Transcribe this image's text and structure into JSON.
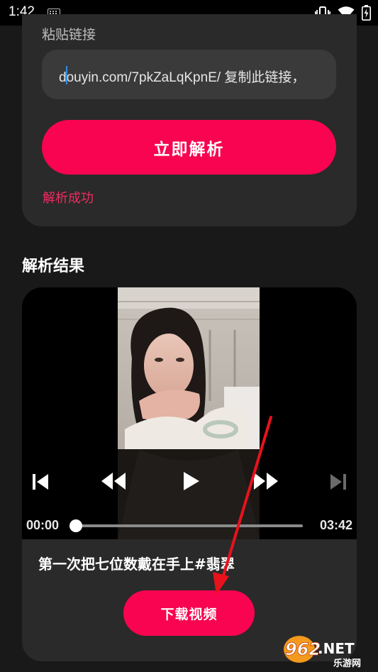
{
  "status_bar": {
    "time": "1:42"
  },
  "parse_card": {
    "paste_label": "粘贴链接",
    "input_value": "douyin.com/7pkZaLqKpnE/ 复制此链接，",
    "parse_button": "立即解析",
    "status_text": "解析成功"
  },
  "result": {
    "section_title": "解析结果",
    "player": {
      "current_time": "00:00",
      "total_time": "03:42",
      "progress": 0
    },
    "video_title": "第一次把七位数戴在手上#翡翠",
    "download_button": "下载视频"
  },
  "watermark": {
    "brand": "962.NET",
    "sub": "乐游网"
  },
  "colors": {
    "accent": "#f80450",
    "background": "#191919",
    "card": "#2a2a2a"
  },
  "icons": [
    "keyboard-icon",
    "vibrate-icon",
    "wifi-icon",
    "battery-icon",
    "skip-previous-icon",
    "rewind-icon",
    "play-icon",
    "fast-forward-icon",
    "skip-next-icon"
  ]
}
